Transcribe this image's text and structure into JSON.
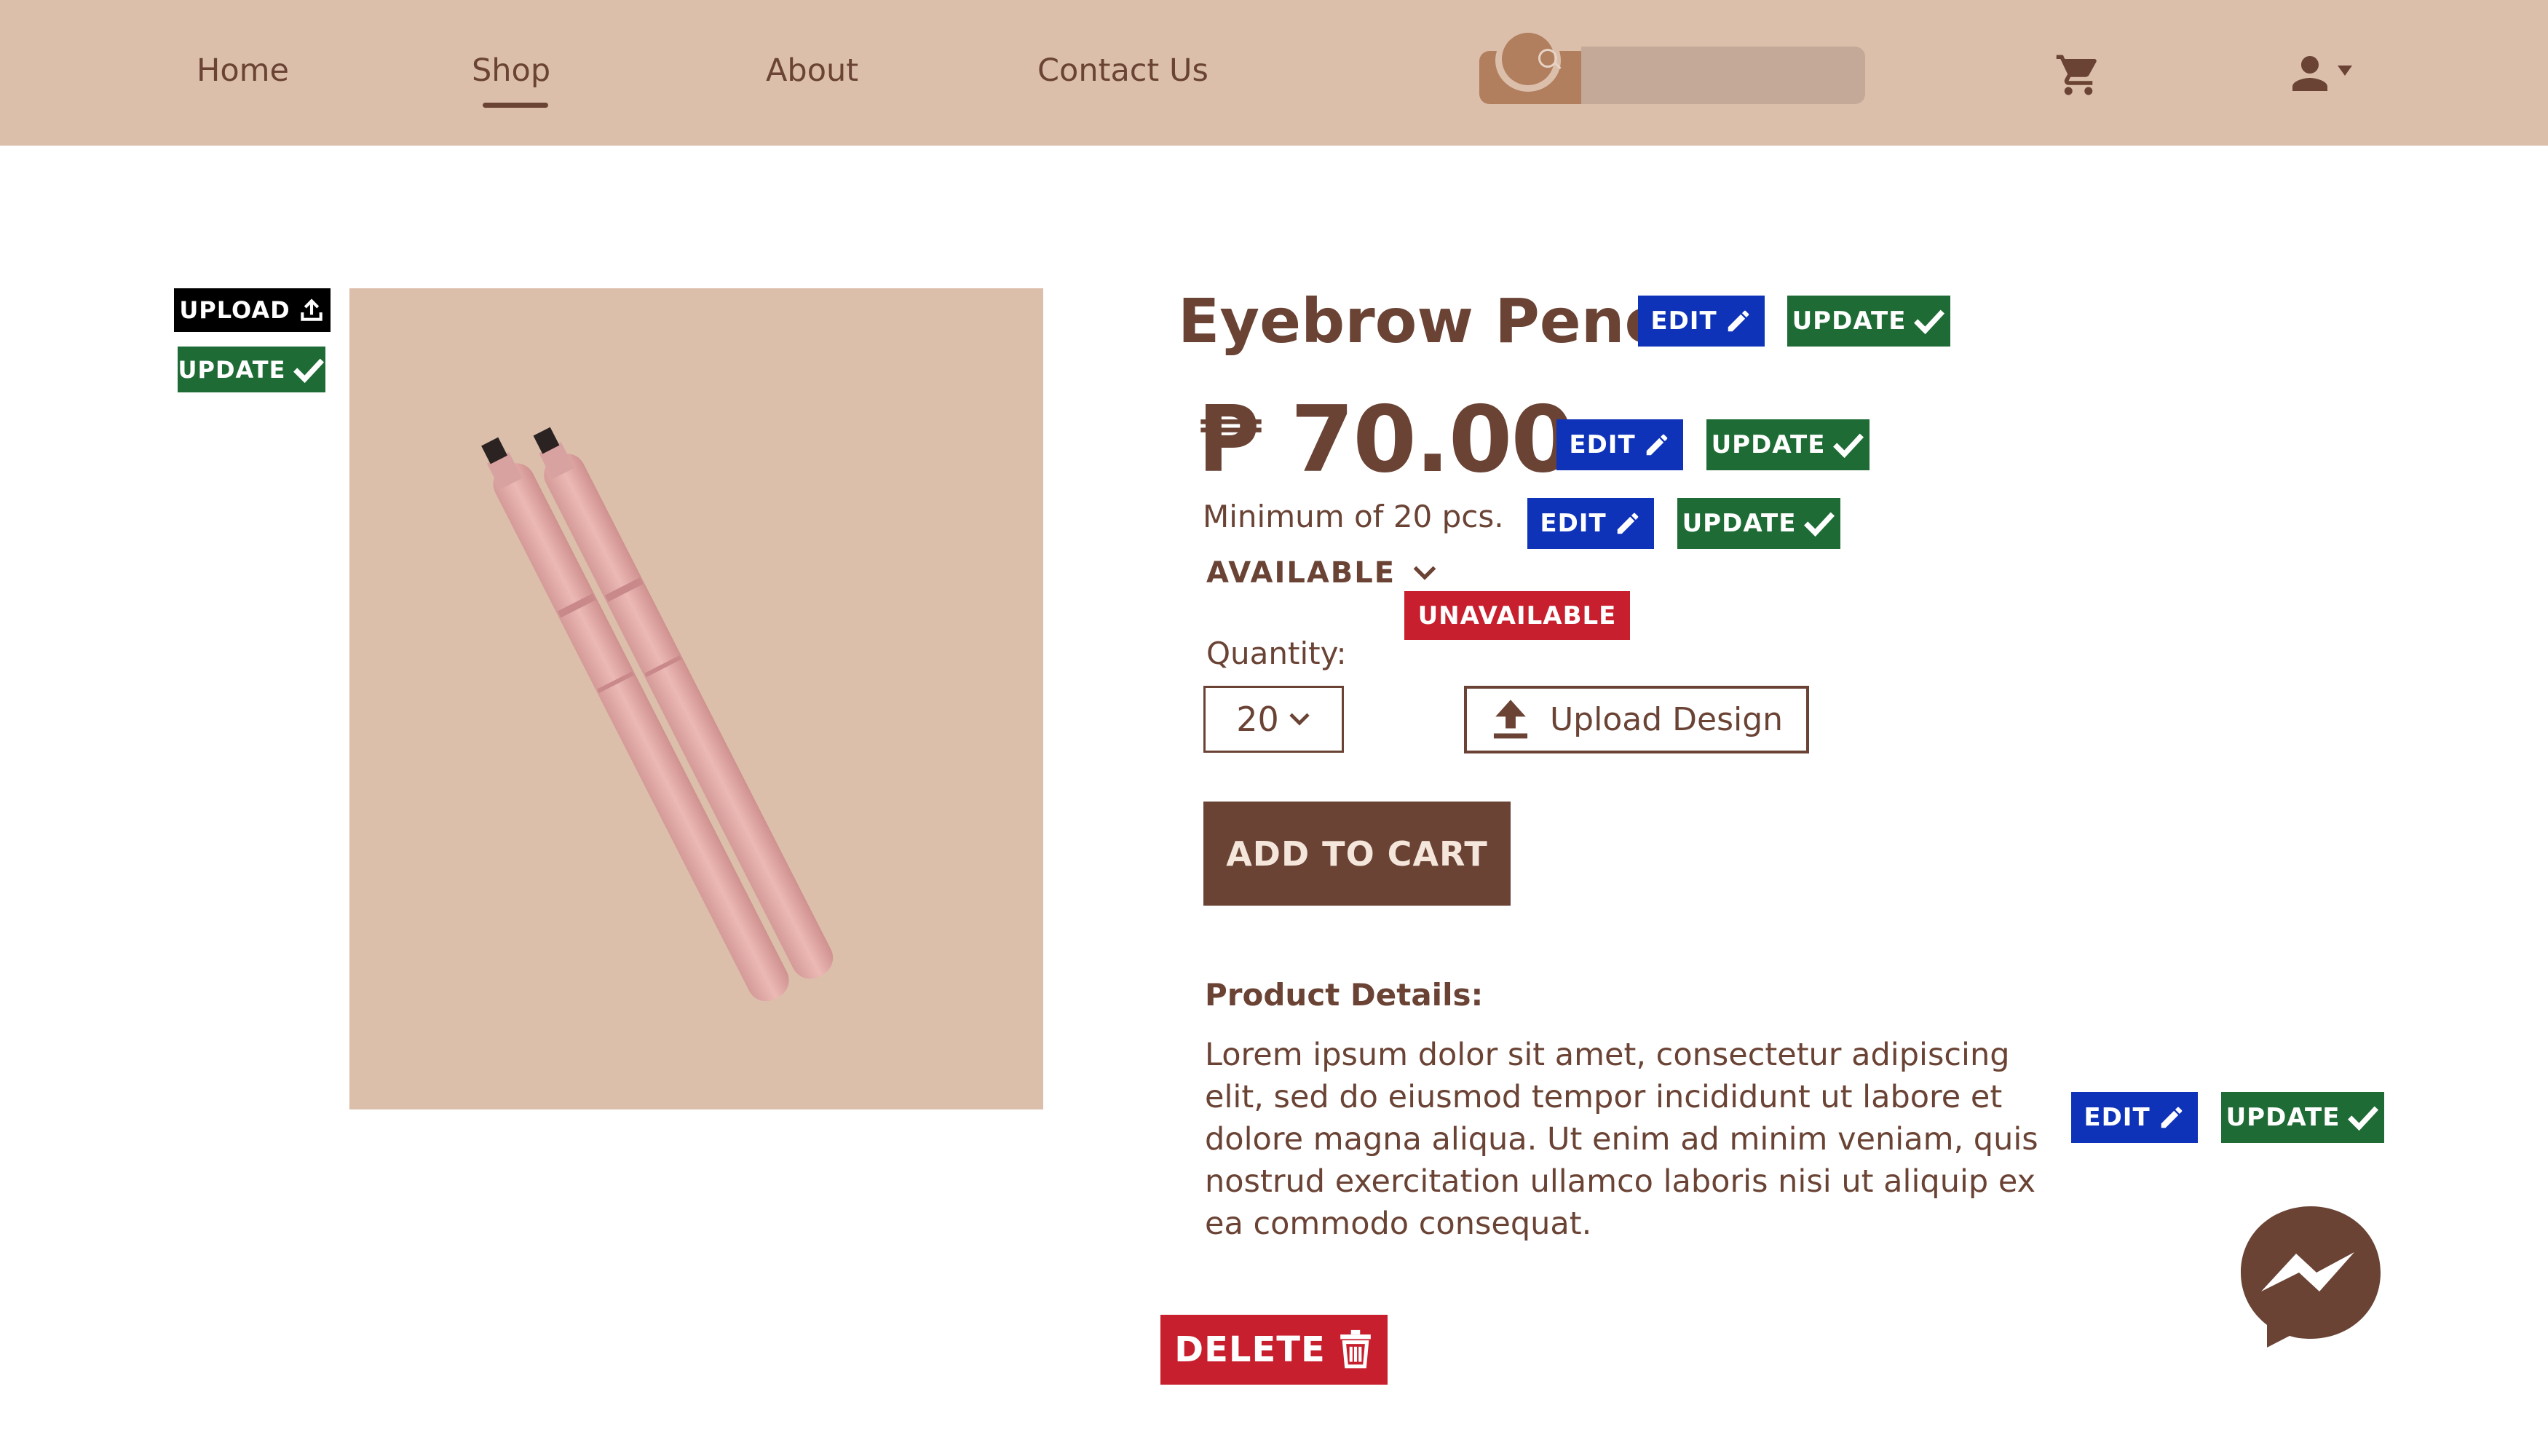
{
  "nav": {
    "items": [
      {
        "label": "Home"
      },
      {
        "label": "Shop"
      },
      {
        "label": "About"
      },
      {
        "label": "Contact Us"
      }
    ],
    "active": "Shop"
  },
  "search": {
    "placeholder": ""
  },
  "image_controls": {
    "upload_label": "UPLOAD",
    "update_label": "UPDATE"
  },
  "product": {
    "title": "Eyebrow Pencil",
    "price": "₱ 70.00",
    "min_order": "Minimum of 20 pcs.",
    "availability": "AVAILABLE",
    "unavailable_option": "UNAVAILABLE",
    "quantity_label": "Quantity:",
    "quantity_value": "20",
    "upload_design_label": "Upload Design",
    "add_to_cart_label": "ADD TO CART",
    "details_heading": "Product Details:",
    "details_text": "Lorem ipsum dolor sit amet, consectetur adipiscing elit, sed do eiusmod tempor incididunt ut labore et dolore magna aliqua. Ut enim ad minim veniam, quis nostrud exercitation ullamco laboris nisi ut aliquip ex ea commodo consequat."
  },
  "admin": {
    "edit_label": "EDIT",
    "update_label": "UPDATE",
    "delete_label": "DELETE"
  },
  "colors": {
    "header_bg": "#dbbfab",
    "brand_brown": "#6a4335",
    "edit_blue": "#0f33b8",
    "update_green": "#1e6b35",
    "delete_red": "#c71f2d"
  },
  "icons": [
    "search-icon",
    "cart-icon",
    "user-icon",
    "upload-icon",
    "pencil-icon",
    "checkmark-icon",
    "chevron-down-icon",
    "trash-icon",
    "messenger-icon"
  ]
}
